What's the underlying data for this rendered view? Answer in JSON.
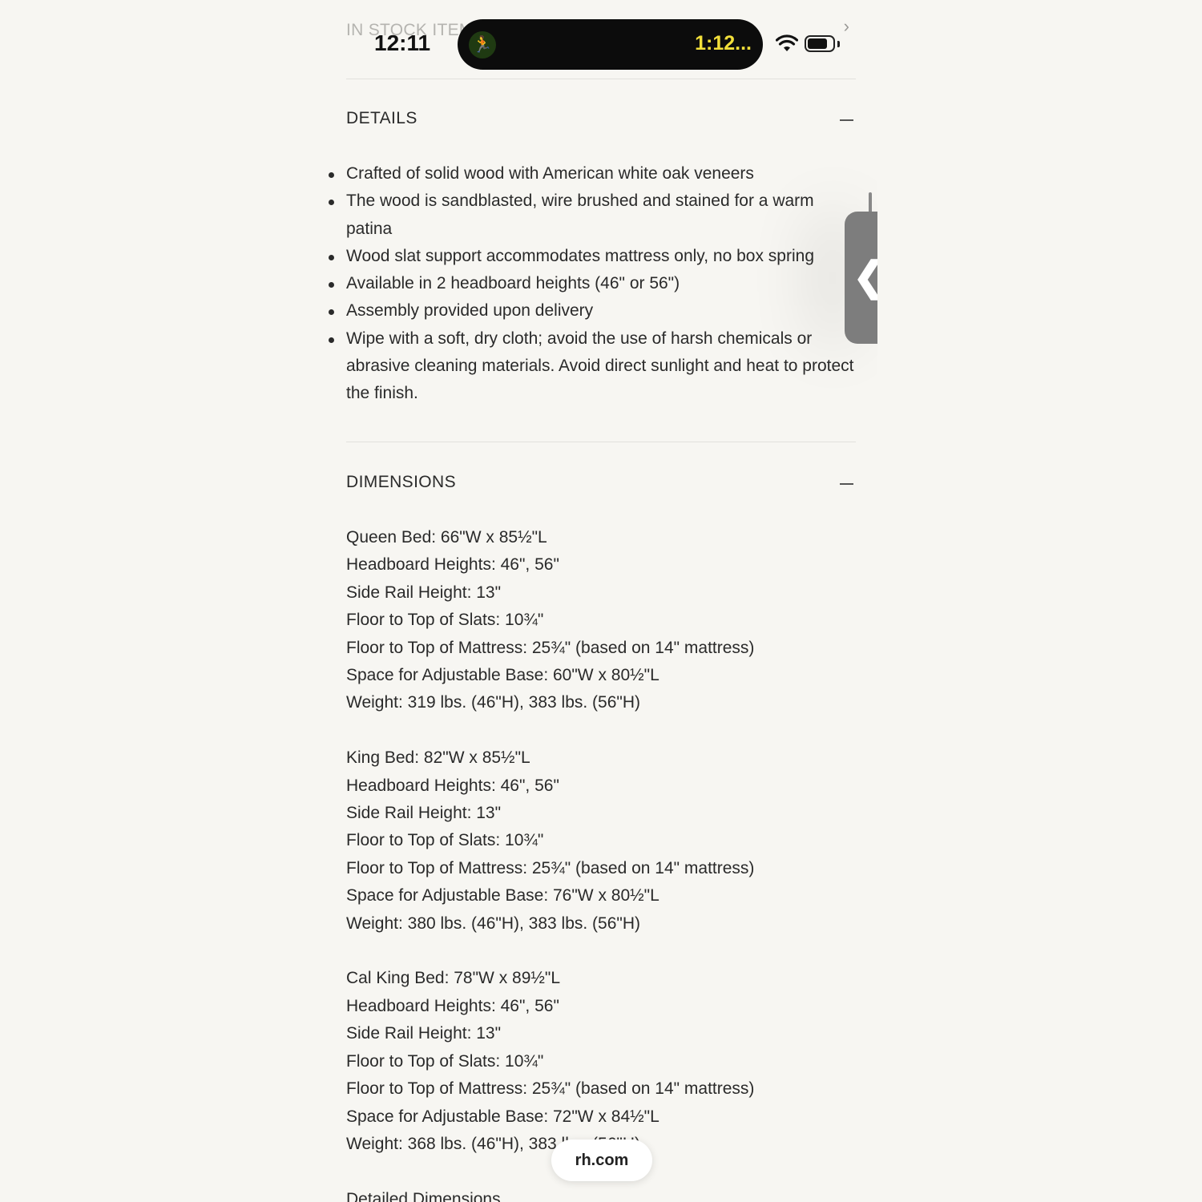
{
  "status_bar": {
    "time": "12:11",
    "activity_timer": "1:12...",
    "activity_icon": "treadmill-icon",
    "icons": [
      "wifi-icon",
      "battery-icon"
    ]
  },
  "stock": {
    "label": "IN STOCK ITEMS",
    "chevron": "›"
  },
  "details": {
    "title": "DETAILS",
    "items": [
      "Crafted of solid wood with American white oak veneers",
      "The wood is sandblasted, wire brushed and stained for a warm patina",
      "Wood slat support accommodates mattress only, no box spring",
      "Available in 2 headboard heights (46\" or 56\")",
      "Assembly provided upon delivery",
      "Wipe with a soft, dry cloth; avoid the use of harsh chemicals or abrasive cleaning materials. Avoid direct sunlight and heat to protect the finish."
    ]
  },
  "dimensions": {
    "title": "DIMENSIONS",
    "groups": [
      [
        "Queen Bed: 66\"W x 85½\"L",
        "Headboard Heights: 46\", 56\"",
        "Side Rail Height: 13\"",
        "Floor to Top of Slats: 10¾\"",
        "Floor to Top of Mattress: 25¾\" (based on 14\" mattress)",
        "Space for Adjustable Base: 60\"W x 80½\"L",
        "Weight: 319 lbs. (46\"H), 383 lbs. (56\"H)"
      ],
      [
        "King Bed: 82\"W x 85½\"L",
        "Headboard Heights: 46\", 56\"",
        "Side Rail Height: 13\"",
        "Floor to Top of Slats: 10¾\"",
        "Floor to Top of Mattress: 25¾\" (based on 14\" mattress)",
        "Space for Adjustable Base: 76\"W x 80½\"L",
        "Weight: 380 lbs. (46\"H), 383 lbs. (56\"H)"
      ],
      [
        "Cal King Bed: 78\"W x 89½\"L",
        "Headboard Heights: 46\", 56\"",
        "Side Rail Height: 13\"",
        "Floor to Top of Slats: 10¾\"",
        "Floor to Top of Mattress: 25¾\" (based on 14\" mattress)",
        "Space for Adjustable Base: 72\"W x 84½\"L",
        "Weight: 368 lbs. (46\"H), 383 lbs. (56\"H)"
      ]
    ],
    "detailed_link": "Detailed Dimensions"
  },
  "browser": {
    "url": "rh.com"
  },
  "side_tab": {
    "chevron": "❮"
  }
}
